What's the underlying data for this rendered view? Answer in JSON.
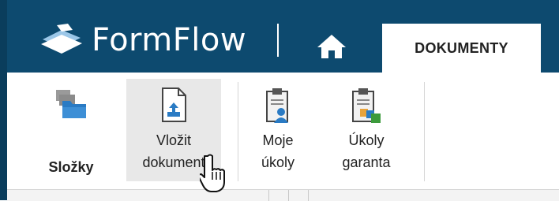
{
  "app": {
    "brand": "FormFlow"
  },
  "header": {
    "active_tab": "DOKUMENTY"
  },
  "ribbon": {
    "buttons": [
      {
        "id": "slozky",
        "label": "Složky"
      },
      {
        "id": "vlozit",
        "label": "Vložit\ndokument"
      },
      {
        "id": "moje",
        "label": "Moje\núkoly"
      },
      {
        "id": "garanta",
        "label": "Úkoly\ngaranta"
      }
    ]
  },
  "colors": {
    "header_bg": "#0d4a6f",
    "hover_bg": "#e8e8e8",
    "accent_blue": "#2a7bc4",
    "accent_green": "#3c9a3c",
    "accent_orange": "#e8a33a"
  },
  "icons": {
    "logo": "formflow-logo-icon",
    "home": "home-icon",
    "folders": "folders-icon",
    "insert": "insert-document-icon",
    "my_tasks": "clipboard-user-icon",
    "guarantor_tasks": "clipboard-group-icon",
    "cursor": "hand-pointer-icon"
  }
}
